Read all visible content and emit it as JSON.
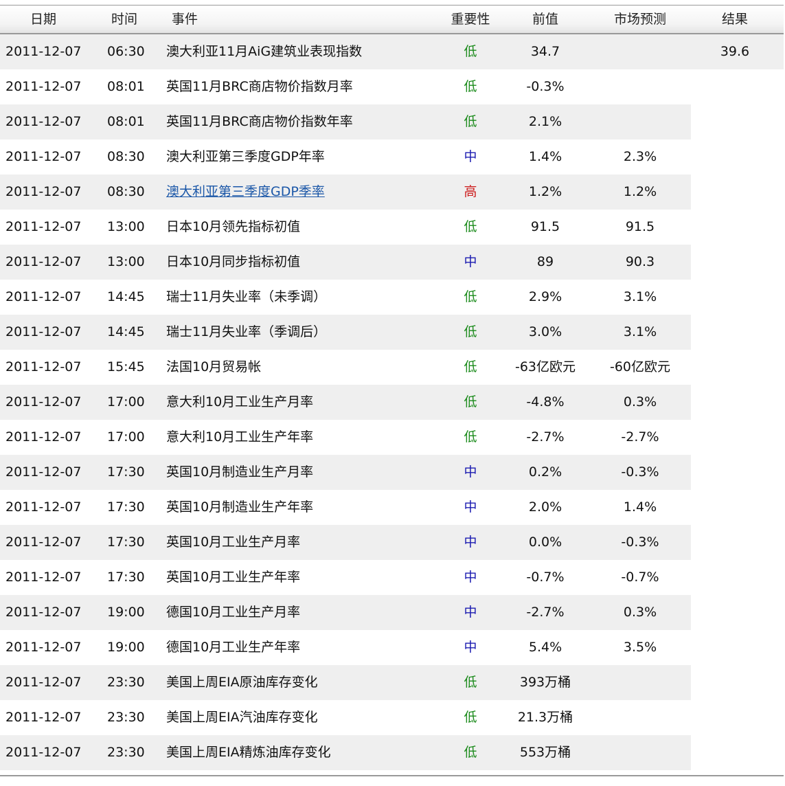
{
  "table": {
    "headers": {
      "date": "日期",
      "time": "时间",
      "event": "事件",
      "importance": "重要性",
      "previous": "前值",
      "forecast": "市场预测",
      "result": "结果"
    },
    "importance_colors": {
      "低": "#1a8a1a",
      "中": "#1a1ab0",
      "高": "#cc1a1a"
    },
    "link_color": "#1b57a8",
    "rows": [
      {
        "date": "2011-12-07",
        "time": "06:30",
        "event": "澳大利亚11月AiG建筑业表现指数",
        "importance": "低",
        "previous": "34.7",
        "forecast": "",
        "result": "39.6"
      },
      {
        "date": "2011-12-07",
        "time": "08:01",
        "event": "英国11月BRC商店物价指数月率",
        "importance": "低",
        "previous": "-0.3%",
        "forecast": "",
        "result": ""
      },
      {
        "date": "2011-12-07",
        "time": "08:01",
        "event": "英国11月BRC商店物价指数年率",
        "importance": "低",
        "previous": "2.1%",
        "forecast": "",
        "result": ""
      },
      {
        "date": "2011-12-07",
        "time": "08:30",
        "event": "澳大利亚第三季度GDP年率",
        "importance": "中",
        "previous": "1.4%",
        "forecast": "2.3%",
        "result": ""
      },
      {
        "date": "2011-12-07",
        "time": "08:30",
        "event": "澳大利亚第三季度GDP季率",
        "importance": "高",
        "previous": "1.2%",
        "forecast": "1.2%",
        "result": "",
        "link": true
      },
      {
        "date": "2011-12-07",
        "time": "13:00",
        "event": "日本10月领先指标初值",
        "importance": "低",
        "previous": "91.5",
        "forecast": "91.5",
        "result": ""
      },
      {
        "date": "2011-12-07",
        "time": "13:00",
        "event": "日本10月同步指标初值",
        "importance": "中",
        "previous": "89",
        "forecast": "90.3",
        "result": ""
      },
      {
        "date": "2011-12-07",
        "time": "14:45",
        "event": "瑞士11月失业率（未季调）",
        "importance": "低",
        "previous": "2.9%",
        "forecast": "3.1%",
        "result": ""
      },
      {
        "date": "2011-12-07",
        "time": "14:45",
        "event": "瑞士11月失业率（季调后）",
        "importance": "低",
        "previous": "3.0%",
        "forecast": "3.1%",
        "result": ""
      },
      {
        "date": "2011-12-07",
        "time": "15:45",
        "event": "法国10月贸易帐",
        "importance": "低",
        "previous": "-63亿欧元",
        "forecast": "-60亿欧元",
        "result": ""
      },
      {
        "date": "2011-12-07",
        "time": "17:00",
        "event": "意大利10月工业生产月率",
        "importance": "低",
        "previous": "-4.8%",
        "forecast": "0.3%",
        "result": ""
      },
      {
        "date": "2011-12-07",
        "time": "17:00",
        "event": "意大利10月工业生产年率",
        "importance": "低",
        "previous": "-2.7%",
        "forecast": "-2.7%",
        "result": ""
      },
      {
        "date": "2011-12-07",
        "time": "17:30",
        "event": "英国10月制造业生产月率",
        "importance": "中",
        "previous": "0.2%",
        "forecast": "-0.3%",
        "result": ""
      },
      {
        "date": "2011-12-07",
        "time": "17:30",
        "event": "英国10月制造业生产年率",
        "importance": "中",
        "previous": "2.0%",
        "forecast": "1.4%",
        "result": ""
      },
      {
        "date": "2011-12-07",
        "time": "17:30",
        "event": "英国10月工业生产月率",
        "importance": "中",
        "previous": "0.0%",
        "forecast": "-0.3%",
        "result": ""
      },
      {
        "date": "2011-12-07",
        "time": "17:30",
        "event": "英国10月工业生产年率",
        "importance": "中",
        "previous": "-0.7%",
        "forecast": "-0.7%",
        "result": ""
      },
      {
        "date": "2011-12-07",
        "time": "19:00",
        "event": "德国10月工业生产月率",
        "importance": "中",
        "previous": "-2.7%",
        "forecast": "0.3%",
        "result": ""
      },
      {
        "date": "2011-12-07",
        "time": "19:00",
        "event": "德国10月工业生产年率",
        "importance": "中",
        "previous": "5.4%",
        "forecast": "3.5%",
        "result": ""
      },
      {
        "date": "2011-12-07",
        "time": "23:30",
        "event": "美国上周EIA原油库存变化",
        "importance": "低",
        "previous": "393万桶",
        "forecast": "",
        "result": ""
      },
      {
        "date": "2011-12-07",
        "time": "23:30",
        "event": "美国上周EIA汽油库存变化",
        "importance": "低",
        "previous": "21.3万桶",
        "forecast": "",
        "result": ""
      },
      {
        "date": "2011-12-07",
        "time": "23:30",
        "event": "美国上周EIA精炼油库存变化",
        "importance": "低",
        "previous": "553万桶",
        "forecast": "",
        "result": ""
      }
    ]
  }
}
